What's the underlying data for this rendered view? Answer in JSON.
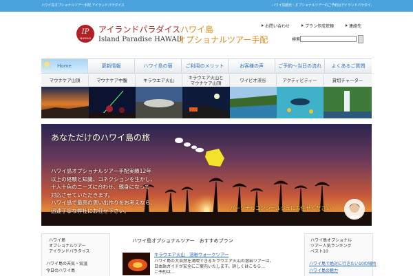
{
  "topbar": {
    "left_text": "ハワイ島オプショナルツアー手配 アイランドパラダイス",
    "right_text": "ハワイ島観光・オプショナルツアーのご予約はアイランドパラダイスへ"
  },
  "logo": {
    "mark": "IP",
    "mark_sub": "HAWAII",
    "name_jp": "アイランドパラダイス",
    "name_en": "Island Paradise HAWAII",
    "tagline_1": "ハワイ島",
    "tagline_2": "オプショナルツアー手配"
  },
  "header_links": {
    "contact": "お問い合わせ",
    "plan": "プラン作成依頼",
    "address": "連絡先"
  },
  "search": {
    "label": "検索:",
    "placeholder": ""
  },
  "nav": {
    "home": "Home",
    "news": "更新情報",
    "hotels": "ハワイ島の宿",
    "merits": "ご利用のメリット",
    "voices": "お客様の声",
    "flow": "ご予約～当日の流れ",
    "faq": "よくあるご質問"
  },
  "areas": {
    "a1": "マウナケア山頂",
    "a2": "マウナケア中腹",
    "a3": "キラウエア火山",
    "a4_l1": "キラウエア火山と",
    "a4_l2": "マウナケア山頂",
    "a5": "ワイピオ渓谷",
    "a6": "アクティビティー",
    "a7": "貸切チャーター"
  },
  "hero": {
    "title": "あなただけのハワイ島の旅",
    "line1": "ハワイ島オプショナルツアー手配実績12年",
    "line2": "以上の経験と知識、コネクションを生かし、",
    "line3": "十人十色のニーズに合わせ、親身になって",
    "line4": "対応させていただきます。",
    "line5": "ハワイ島で最高の思い出作りをお考えなら、",
    "line6": "迅速丁寧な弊社にお任せ下さい。",
    "consult": "パーソナルコンシェルジュにお任せください"
  },
  "left_col": {
    "l1": "ハワイ島",
    "l2": "オプショナルツアー",
    "l3": "アイランドパラダイス",
    "l4": "ハワイ島の天気・気温",
    "l5": "今日のハワイ島"
  },
  "middle": {
    "title": "ハワイ島オプショナルツアー　おすすめプラン",
    "news_link": "キラウエア火山　溶岩ウォークツアー",
    "text1": "ハワイ島の大自然を満喫できるキラウエア火山の溶岩ツアーは、",
    "text2": "日本語ガイドが安全にご案内いたします。詳しくはこちら…",
    "text3": "ご予約は…"
  },
  "right_col": {
    "r1": "ハワイ島オプショナル",
    "r2": "ツアー人気ランキング",
    "r3": "ベスト10",
    "r4": "ハワイ島で絶対に行きたい10の場所",
    "r5": "ハワイ島の魅力"
  },
  "colors": {
    "topbar": "#4aa3dc",
    "brand_red": "#b21f24",
    "brand_orange": "#d88f1b",
    "nav_text": "#2c6fb8",
    "link": "#1e62b4"
  }
}
